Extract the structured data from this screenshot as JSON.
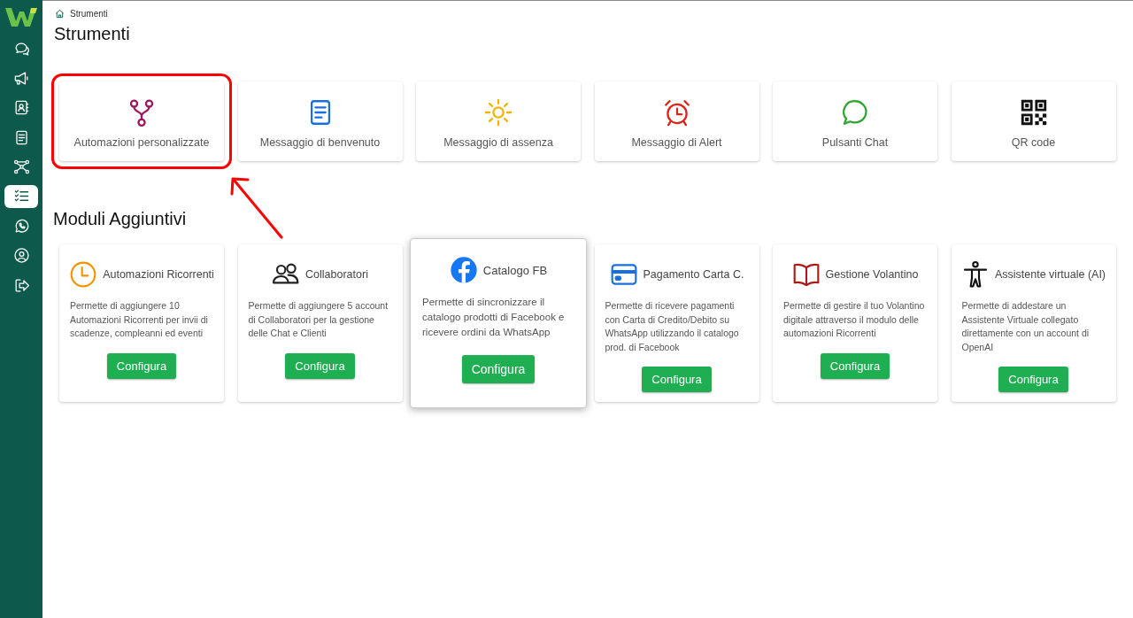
{
  "sidebar": {
    "items": [
      {
        "kind": "chat",
        "selected": false
      },
      {
        "kind": "megaphone",
        "selected": false
      },
      {
        "kind": "contacts",
        "selected": false
      },
      {
        "kind": "document",
        "selected": false
      },
      {
        "kind": "network",
        "selected": false
      },
      {
        "kind": "checklist",
        "selected": true
      },
      {
        "kind": "whatsapp",
        "selected": false
      },
      {
        "kind": "user",
        "selected": false
      },
      {
        "kind": "logout",
        "selected": false
      }
    ]
  },
  "breadcrumb": {
    "current": "Strumenti"
  },
  "title": "Strumenti",
  "tools": [
    {
      "kind": "fork",
      "label": "Automazioni personalizzate",
      "highlighted": true
    },
    {
      "kind": "document",
      "label": "Messaggio di benvenuto",
      "highlighted": false
    },
    {
      "kind": "sun",
      "label": "Messaggio di assenza",
      "highlighted": false
    },
    {
      "kind": "alarm",
      "label": "Messaggio di Alert",
      "highlighted": false
    },
    {
      "kind": "bubble",
      "label": "Pulsanti Chat",
      "highlighted": false
    },
    {
      "kind": "qr",
      "label": "QR code",
      "highlighted": false
    }
  ],
  "modules_title": "Moduli Aggiuntivi",
  "modules": [
    {
      "kind": "clock",
      "title": "Automazioni Ricorrenti",
      "description": "Permette di aggiungere 10 Automazioni Ricorrenti per invii di scadenze, compleanni ed eventi",
      "button": "Configura",
      "elevated": false
    },
    {
      "kind": "people",
      "title": "Collaboratori",
      "description": "Permette di aggiungere 5 account di Collaboratori per la gestione delle Chat e Clienti",
      "button": "Configura",
      "elevated": false
    },
    {
      "kind": "facebook",
      "title": "Catalogo FB",
      "description": "Permette di sincronizzare il catalogo prodotti di Facebook e ricevere ordini da WhatsApp",
      "button": "Configura",
      "elevated": true
    },
    {
      "kind": "card",
      "title": "Pagamento Carta C.",
      "description": "Permette di ricevere pagamenti con Carta di Credito/Debito su WhatsApp utilizzando il catalogo prod. di Facebook",
      "button": "Configura",
      "elevated": false
    },
    {
      "kind": "book",
      "title": "Gestione Volantino",
      "description": "Permette di gestire il tuo Volantino digitale attraverso il modulo delle automazioni Ricorrenti",
      "button": "Configura",
      "elevated": false
    },
    {
      "kind": "person",
      "title": "Assistente virtuale (AI)",
      "description": "Permette di addestare un Assistente Virtuale collegato direttamente con un account di OpenAI",
      "button": "Configura",
      "elevated": false
    }
  ]
}
